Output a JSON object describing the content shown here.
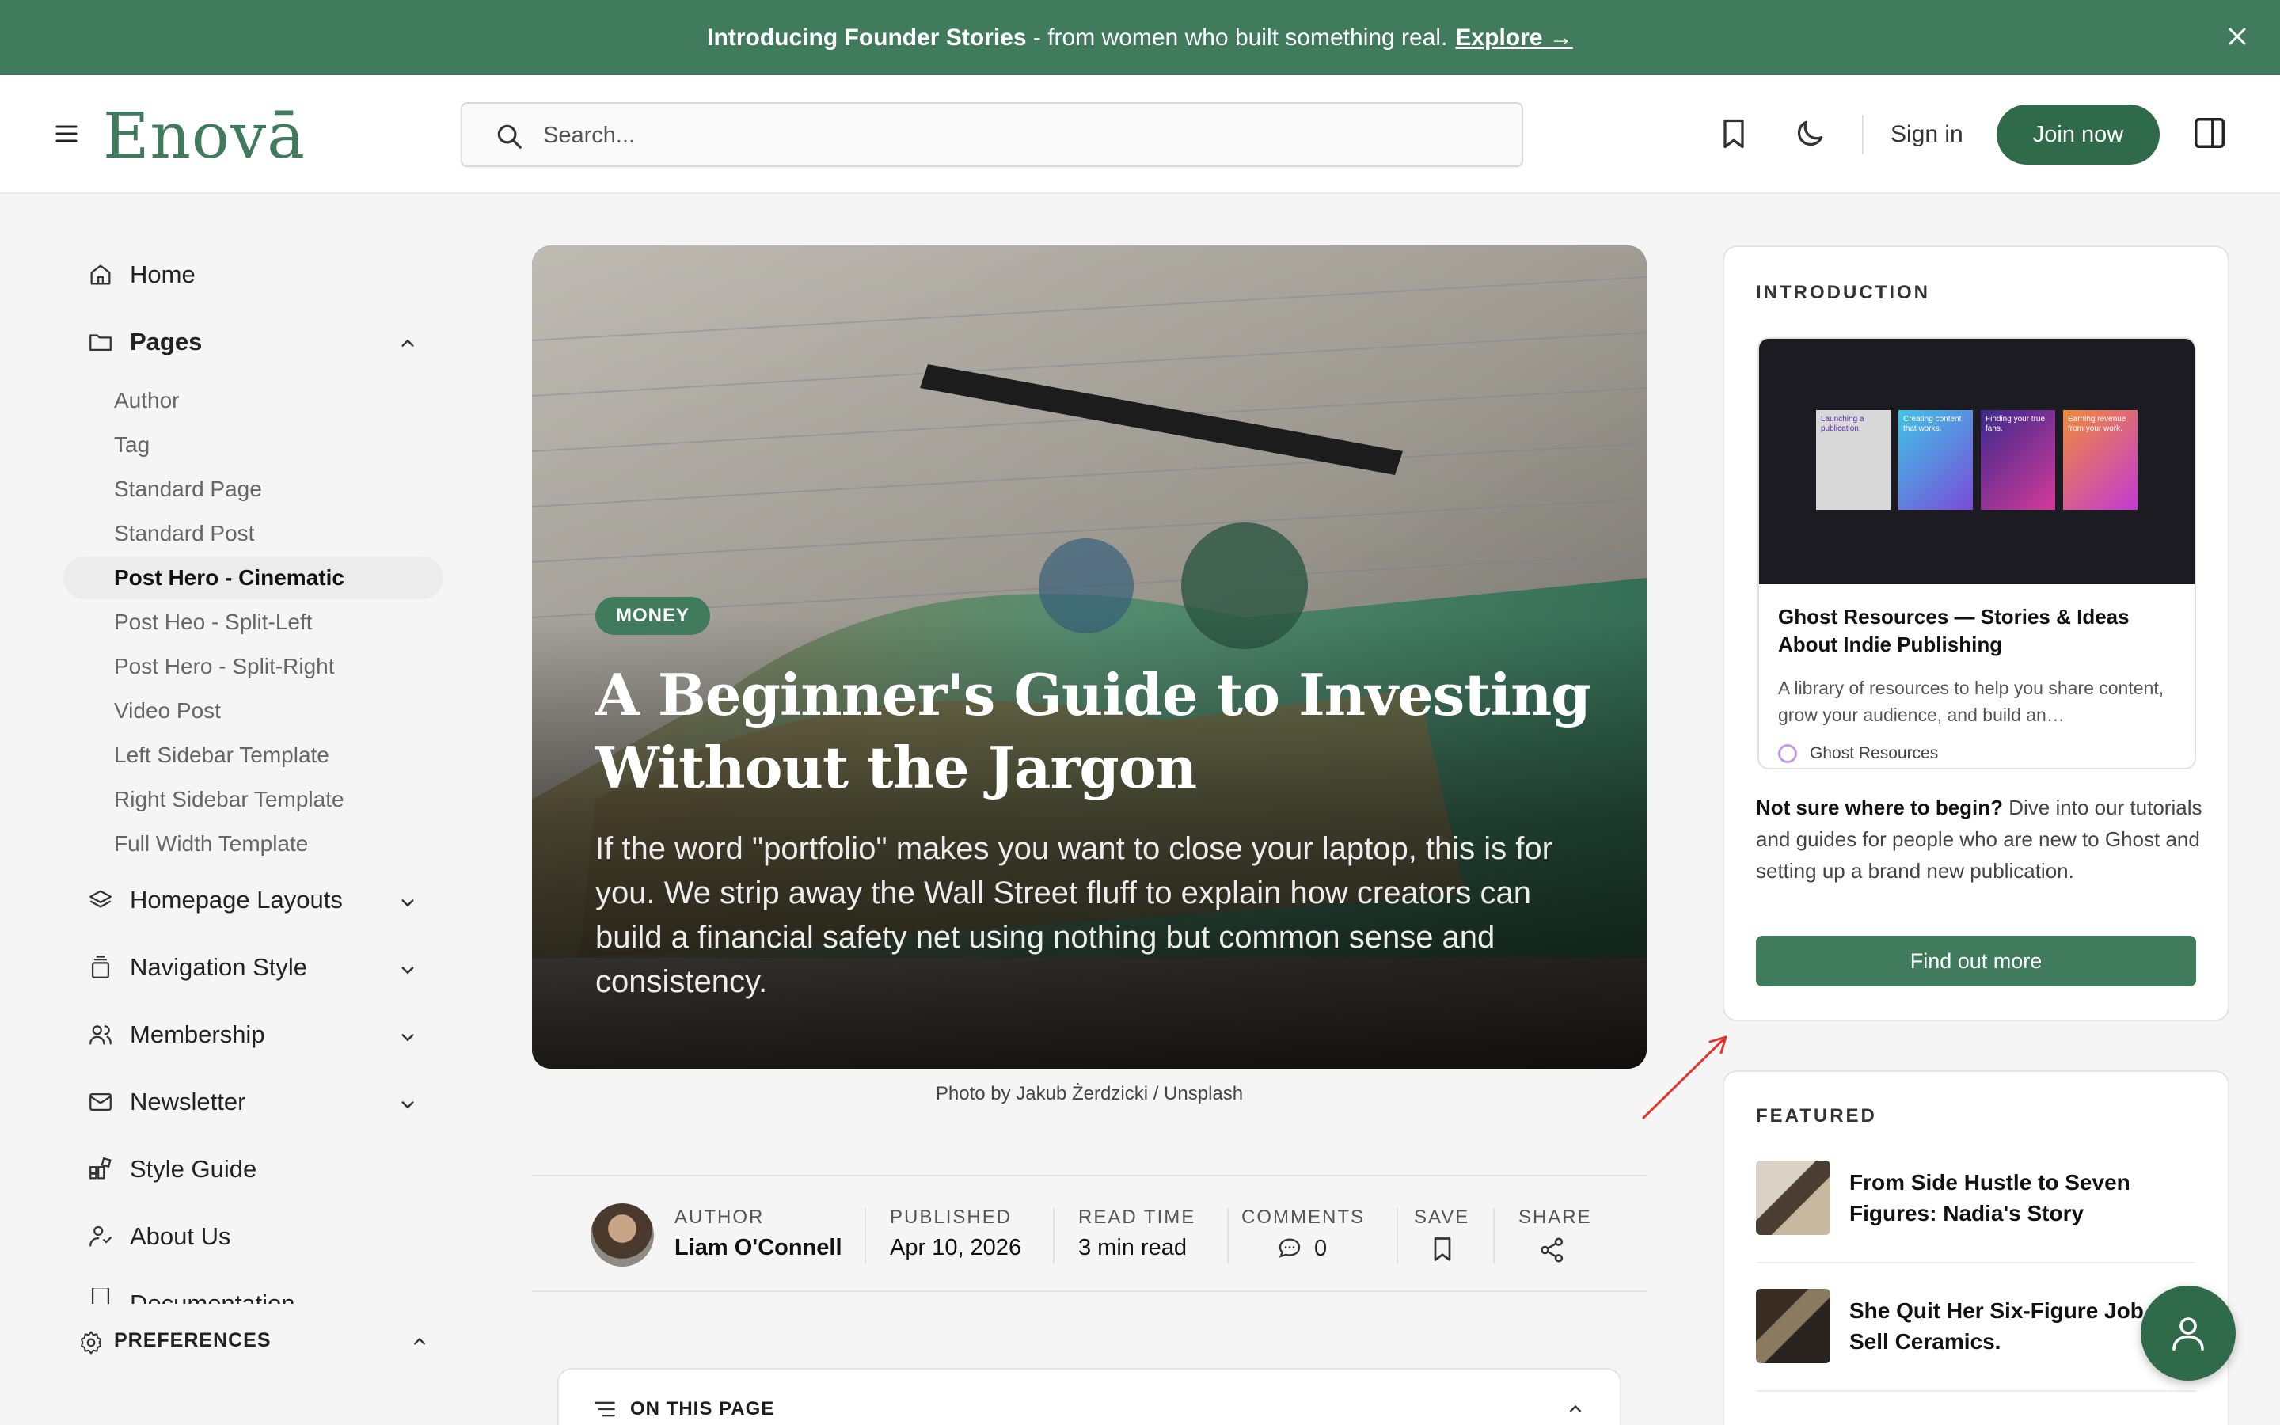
{
  "announcement": {
    "bold": "Introducing Founder Stories",
    "text": " - from women who built something real.",
    "link": "Explore →"
  },
  "header": {
    "logo": "Enovā",
    "search_placeholder": "Search...",
    "sign_in": "Sign in",
    "join": "Join now"
  },
  "sidebar": {
    "items": [
      {
        "label": "Home",
        "icon": "home-icon"
      },
      {
        "label": "Pages",
        "icon": "folder-icon",
        "expanded": true
      },
      {
        "label": "Homepage Layouts",
        "icon": "layers-icon"
      },
      {
        "label": "Navigation Style",
        "icon": "navigation-icon"
      },
      {
        "label": "Membership",
        "icon": "users-icon"
      },
      {
        "label": "Newsletter",
        "icon": "mail-icon"
      },
      {
        "label": "Style Guide",
        "icon": "blocks-icon"
      },
      {
        "label": "About Us",
        "icon": "person-icon"
      },
      {
        "label": "Documentation",
        "icon": "doc-icon"
      }
    ],
    "pages_sub": [
      "Author",
      "Tag",
      "Standard Page",
      "Standard Post",
      "Post Hero - Cinematic",
      "Post Heo - Split-Left",
      "Post Hero - Split-Right",
      "Video Post",
      "Left Sidebar Template",
      "Right Sidebar Template",
      "Full Width Template"
    ],
    "active_sub": "Post Hero - Cinematic",
    "preferences": "PREFERENCES"
  },
  "hero": {
    "tag": "MONEY",
    "title": "A Beginner's Guide to Investing Without the Jargon",
    "subtitle": "If the word \"portfolio\" makes you want to close your laptop, this is for you. We strip away the Wall Street fluff to explain how creators can build a financial safety net using nothing but common sense and consistency.",
    "caption": "Photo by Jakub Żerdzicki / Unsplash"
  },
  "meta": {
    "author_label": "AUTHOR",
    "author": "Liam O'Connell",
    "published_label": "PUBLISHED",
    "published": "Apr 10, 2026",
    "readtime_label": "READ TIME",
    "readtime": "3 min read",
    "comments_label": "COMMENTS",
    "comments": "0",
    "save_label": "SAVE",
    "share_label": "SHARE"
  },
  "on_this_page": "ON THIS PAGE",
  "introduction": {
    "title": "INTRODUCTION",
    "promo_title": "Ghost Resources — Stories & Ideas About Indie Publishing",
    "promo_desc": "A library of resources to help you share content, grow your audience, and build an…",
    "promo_source": "Ghost Resources",
    "promo_cards": [
      "Launching a publication.",
      "Creating content that works.",
      "Finding your true fans.",
      "Earning revenue from your work."
    ],
    "lead_bold": "Not sure where to begin?",
    "lead_text": " Dive into our tutorials and guides for people who are new to Ghost and setting up a brand new publication.",
    "button": "Find out more"
  },
  "featured": {
    "title": "FEATURED",
    "items": [
      {
        "title": "From Side Hustle to Seven Figures: Nadia's Story"
      },
      {
        "title": "She Quit Her Six-Figure Job to Sell Ceramics."
      }
    ]
  },
  "colors": {
    "brand": "#3f7b5c",
    "brand_dark": "#2f6b4b",
    "annotation_arrow": "#e5342a"
  }
}
